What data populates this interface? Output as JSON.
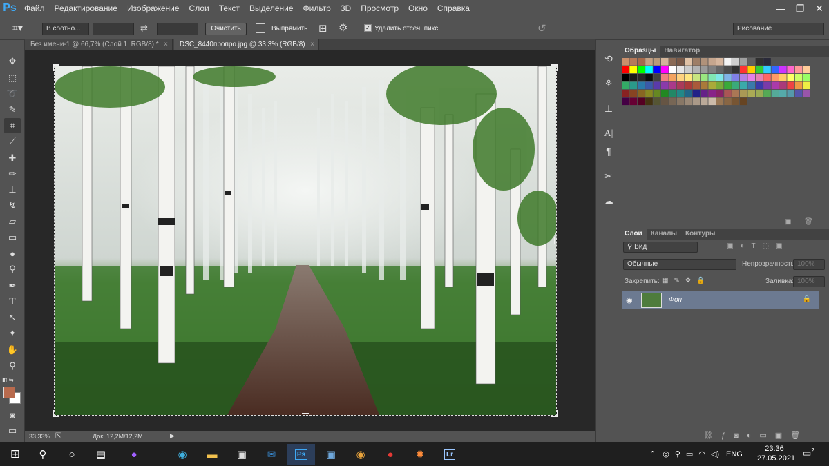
{
  "app": {
    "logo": "Ps"
  },
  "menu": [
    "Файл",
    "Редактирование",
    "Изображение",
    "Слои",
    "Текст",
    "Выделение",
    "Фильтр",
    "3D",
    "Просмотр",
    "Окно",
    "Справка"
  ],
  "window_controls": {
    "minimize": "—",
    "restore": "❐",
    "close": "✕"
  },
  "options_bar": {
    "ratio_select": "В соотно...",
    "swap_icon": "⇄",
    "clear_button": "Очистить",
    "straighten_button": "Выпрямить",
    "delete_cropped_label": "Удалить отсеч. пикс.",
    "workspace_select": "Рисование"
  },
  "tabs": [
    {
      "label": "Без имени-1 @ 66,7% (Слой 1, RGB/8) *",
      "close": "×"
    },
    {
      "label": "DSC_8440пропро.jpg @ 33,3% (RGB/8)",
      "close": "×"
    }
  ],
  "status": {
    "zoom": "33,33%",
    "doc": "Док: 12,2M/12,2M"
  },
  "swatches_panel": {
    "tabs": [
      "Образцы",
      "Навигатор"
    ]
  },
  "layers_panel": {
    "tabs": [
      "Слои",
      "Каналы",
      "Контуры"
    ],
    "filter_select": "Вид",
    "blend_mode": "Обычные",
    "opacity_label": "Непрозрачность:",
    "opacity_value": "100%",
    "lock_label": "Закрепить:",
    "fill_label": "Заливка:",
    "fill_value": "100%",
    "layers": [
      {
        "name": "Фон",
        "locked": true,
        "visible": true
      }
    ]
  },
  "taskbar": {
    "tray_lang": "ENG",
    "time": "23:36",
    "date": "27.05.2021",
    "notifications": "2"
  },
  "colors": {
    "accent": "#3fa9f5",
    "foreground_swatch": "#b86a4d",
    "background_swatch": "#ffffff",
    "layer_selected": "#6c7a91"
  }
}
